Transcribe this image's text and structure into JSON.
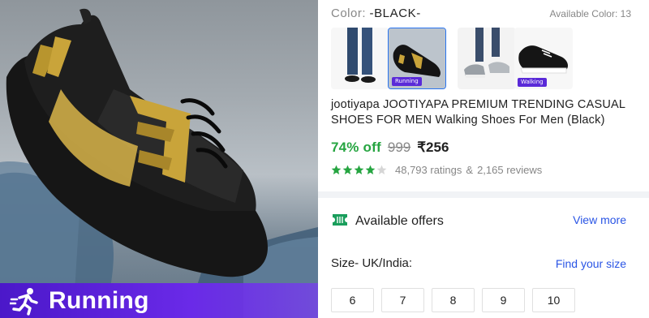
{
  "hero": {
    "tag_label": "Running",
    "tag_icon": "running-person-icon"
  },
  "color": {
    "label": "Color:",
    "value": "-BLACK-",
    "available": "Available Color: 13"
  },
  "thumbnails": [
    {
      "name": "thumb-model-legs",
      "selected": false,
      "badge": ""
    },
    {
      "name": "thumb-black-gold",
      "selected": true,
      "badge": "Running"
    },
    {
      "name": "thumb-grey-pair",
      "selected": false,
      "badge": ""
    },
    {
      "name": "thumb-white-sole",
      "selected": false,
      "badge": "Walking"
    }
  ],
  "product": {
    "title": "jootiyapa JOOTIYAPA PREMIUM TRENDING CASUAL SHOES FOR MEN Walking Shoes For Men  (Black)"
  },
  "price": {
    "discount": "74% off",
    "mrp": "999",
    "sale": "₹256"
  },
  "rating": {
    "stars": 4,
    "ratings": "48,793 ratings",
    "separator": "&",
    "reviews": "2,165 reviews",
    "star_color": "#26a541"
  },
  "offers": {
    "label": "Available offers",
    "view_more": "View more"
  },
  "size": {
    "label": "Size- UK/India:",
    "find": "Find your size",
    "options": [
      "6",
      "7",
      "8",
      "9",
      "10"
    ]
  },
  "colors": {
    "accent_blue": "#2a55e5",
    "discount_green": "#26a541",
    "tag_purple": "#5a2ad8"
  }
}
